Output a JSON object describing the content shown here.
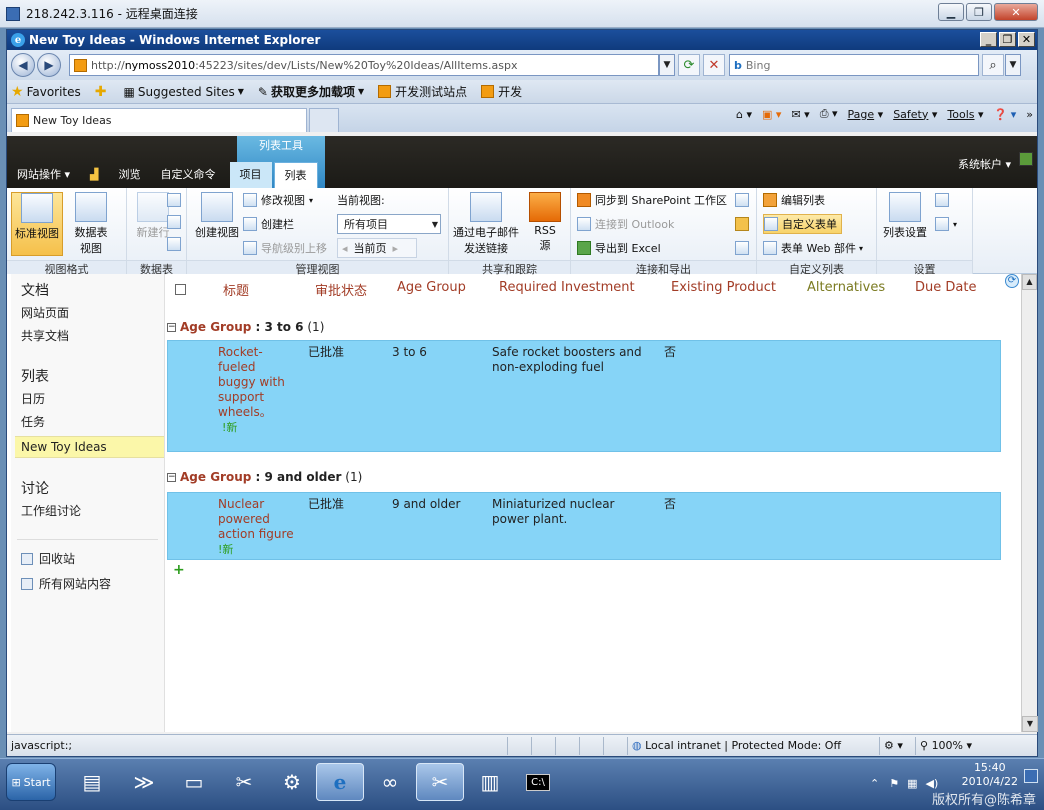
{
  "rdp": {
    "title": "218.242.3.116 - 远程桌面连接"
  },
  "ie": {
    "title": "New Toy Ideas - Windows Internet Explorer",
    "url_prefix": "http://",
    "url_host": "nymoss2010",
    "url_rest": ":45223/sites/dev/Lists/New%20Toy%20Ideas/AllItems.aspx",
    "search_placeholder": "Bing",
    "favorites": [
      "Favorites",
      "Suggested Sites",
      "获取更多加载项",
      "开发测试站点",
      "开发"
    ],
    "tab_title": "New Toy Ideas",
    "cmd": {
      "page": "Page",
      "safety": "Safety",
      "tools": "Tools"
    },
    "status_left": "javascript:;",
    "status_zone": "Local intranet | Protected Mode: Off",
    "zoom": "100%"
  },
  "sp": {
    "site_actions": "网站操作",
    "browse": "浏览",
    "custom_commands": "自定义命令",
    "context_title": "列表工具",
    "tab_items": "项目",
    "tab_list": "列表",
    "user": "系统帐户",
    "ribbon": {
      "standard_view": "标准视图",
      "datasheet_view": "数据表",
      "datasheet_view2": "视图",
      "new_row": "新建行",
      "create_view": "创建视图",
      "modify_view": "修改视图",
      "create_column": "创建栏",
      "nav_up": "导航级别上移",
      "current_view_label": "当前视图:",
      "current_view": "所有项目",
      "current_page": "当前页",
      "email_link": "通过电子邮件",
      "email_link2": "发送链接",
      "rss": "RSS",
      "rss2": "源",
      "sync_sp": "同步到 SharePoint 工作区",
      "connect_outlook": "连接到 Outlook",
      "export_excel": "导出到 Excel",
      "edit_list": "编辑列表",
      "custom_form": "自定义表单",
      "form_web_parts": "表单 Web 部件",
      "list_settings": "列表设置",
      "groups": [
        "视图格式",
        "数据表",
        "管理视图",
        "共享和跟踪",
        "连接和导出",
        "自定义列表",
        "设置"
      ]
    },
    "quicklaunch": {
      "docs_head": "文档",
      "docs": [
        "网站页面",
        "共享文档"
      ],
      "lists_head": "列表",
      "lists": [
        "日历",
        "任务",
        "New Toy Ideas"
      ],
      "discuss_head": "讨论",
      "discuss": [
        "工作组讨论"
      ],
      "recycle": "回收站",
      "all_content": "所有网站内容"
    },
    "columns": [
      "标题",
      "审批状态",
      "Age Group",
      "Required Investment",
      "Existing Product",
      "Alternatives",
      "Due Date"
    ],
    "groups": [
      {
        "label": "Age Group",
        "value": "3 to 6",
        "count": "(1)",
        "item": {
          "title": "Rocket-fueled buggy with support wheels。",
          "badge": "!新",
          "status": "已批准",
          "age": "3 to 6",
          "investment": "Safe rocket boosters and non-exploding fuel",
          "existing": "否"
        }
      },
      {
        "label": "Age Group",
        "value": "9 and older",
        "count": "(1)",
        "item": {
          "title": "Nuclear powered action figure",
          "badge": "!新",
          "status": "已批准",
          "age": "9 and older",
          "investment": "Miniaturized nuclear power plant.",
          "existing": "否"
        }
      }
    ]
  },
  "taskbar": {
    "start": "Start",
    "time": "15:40",
    "date": "2010/4/22",
    "watermark": "版权所有@陈希章"
  }
}
